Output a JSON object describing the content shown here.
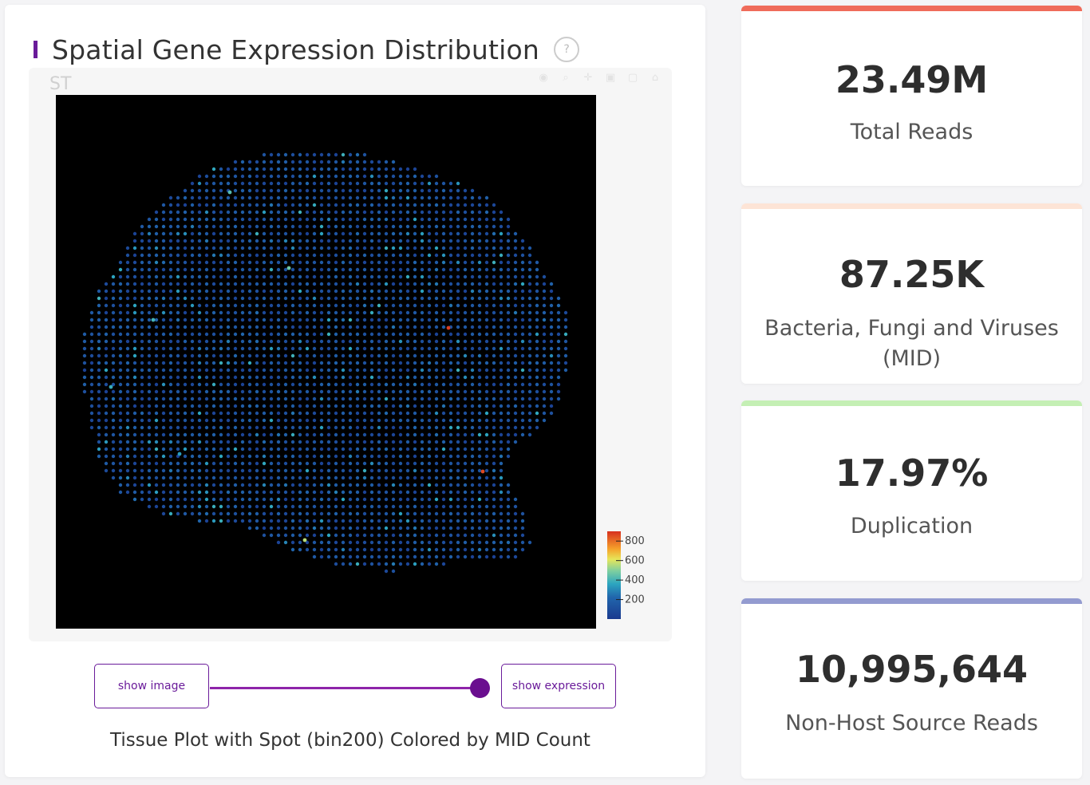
{
  "panel": {
    "title": "Spatial Gene Expression Distribution",
    "help_symbol": "?"
  },
  "plot": {
    "label": "ST",
    "modebar_icons": [
      "camera-icon",
      "zoom-icon",
      "pan-icon",
      "zoom-in-icon",
      "zoom-out-icon",
      "reset-icon"
    ],
    "background_color": "#000000",
    "colorscale": "Spectral",
    "colorbar_ticks": [
      "800",
      "600",
      "400",
      "200"
    ]
  },
  "chart_data": {
    "type": "scatter",
    "title": "",
    "xlabel": "",
    "ylabel": "",
    "colorbar": {
      "ticks": [
        200,
        400,
        600,
        800
      ],
      "range": [
        0,
        900
      ]
    },
    "highlight_points": [
      {
        "id": "hotspot-a",
        "value": 880
      },
      {
        "id": "hotspot-b",
        "value": 860
      },
      {
        "id": "hotspot-c",
        "value": 560
      },
      {
        "id": "hotspot-d",
        "value": 470
      },
      {
        "id": "hotspot-e",
        "value": 430
      },
      {
        "id": "hotspot-f",
        "value": 400
      },
      {
        "id": "hotspot-g",
        "value": 380
      },
      {
        "id": "hotspot-h",
        "value": 340
      }
    ]
  },
  "controls": {
    "show_image_label": "show image",
    "show_expression_label": "show expression",
    "slider_value": 1.0
  },
  "caption": "Tissue Plot with Spot (bin200) Colored by MID Count",
  "stats": [
    {
      "value": "23.49M",
      "label": "Total Reads",
      "color": "#ef6b5a"
    },
    {
      "value": "87.25K",
      "label": "Bacteria, Fungi and Viruses (MID)",
      "color": "#fde4d6"
    },
    {
      "value": "17.97%",
      "label": "Duplication",
      "color": "#c4efb4"
    },
    {
      "value": "10,995,644",
      "label": "Non-Host Source Reads",
      "color": "#939bd0"
    }
  ]
}
